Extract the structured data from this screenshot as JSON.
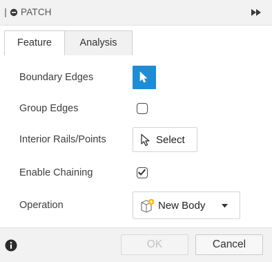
{
  "dialog": {
    "title": "PATCH"
  },
  "tabs": [
    {
      "label": "Feature",
      "active": true
    },
    {
      "label": "Analysis",
      "active": false
    }
  ],
  "fields": {
    "boundary_edges": {
      "label": "Boundary Edges",
      "state": "selecting"
    },
    "group_edges": {
      "label": "Group Edges",
      "checked": false
    },
    "interior_rails": {
      "label": "Interior Rails/Points",
      "button": "Select"
    },
    "enable_chaining": {
      "label": "Enable Chaining",
      "checked": true
    },
    "operation": {
      "label": "Operation",
      "value": "New Body"
    }
  },
  "footer": {
    "ok_label": "OK",
    "ok_enabled": false,
    "cancel_label": "Cancel"
  },
  "colors": {
    "accent": "#1f8dd6",
    "title_bar": "#f2f2f2",
    "disabled_text": "#c2c2c2",
    "body_icon_accent": "#f5b800"
  },
  "icons": {
    "title_left": "filled-circle-icon",
    "title_right": "fast-forward-icon",
    "boundary_selector": "cursor-arrow-icon",
    "interior_select": "cursor-outline-icon",
    "operation": "new-body-icon",
    "dropdown": "caret-down-icon",
    "footer_info": "info-icon"
  }
}
